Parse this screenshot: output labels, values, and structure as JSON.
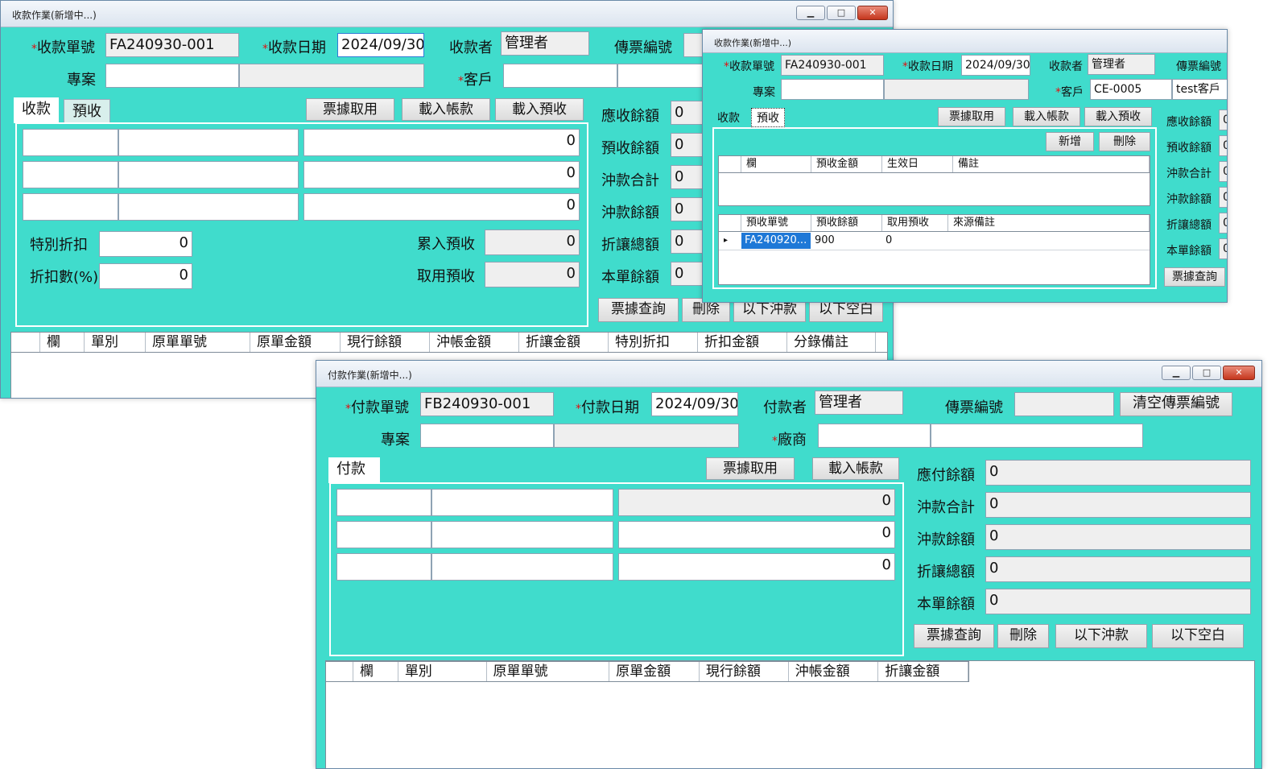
{
  "w1": {
    "title": "收款作業(新增中...)",
    "lbl_no": "收款單號",
    "no": "FA240930-001",
    "lbl_date": "收款日期",
    "date": "2024/09/30",
    "lbl_user": "收款者",
    "user": "管理者",
    "lbl_voucher": "傳票編號",
    "lbl_project": "專案",
    "lbl_customer": "客戶",
    "tab_receipt": "收款",
    "tab_prepay": "預收",
    "btn_take": "票據取用",
    "btn_load_acct": "載入帳款",
    "btn_load_pre": "載入預收",
    "amounts": [
      "0",
      "0",
      "0"
    ],
    "lbl_special": "特別折扣",
    "special": "0",
    "lbl_rate": "折扣數(%)",
    "rate": "0",
    "lbl_acc_pre": "累入預收",
    "acc_pre": "0",
    "lbl_take_pre": "取用預收",
    "take_pre": "0",
    "summary": [
      {
        "label": "應收餘額",
        "value": "0"
      },
      {
        "label": "預收餘額",
        "value": "0"
      },
      {
        "label": "沖款合計",
        "value": "0"
      },
      {
        "label": "沖款餘額",
        "value": "0"
      },
      {
        "label": "折讓總額",
        "value": "0"
      },
      {
        "label": "本單餘額",
        "value": "0"
      }
    ],
    "btn_query": "票據查詢",
    "btn_delete": "刪除",
    "btn_below_offset": "以下沖款",
    "btn_below_blank": "以下空白",
    "columns": [
      "欄",
      "單別",
      "原單單號",
      "原單金額",
      "現行餘額",
      "沖帳金額",
      "折讓金額",
      "特別折扣",
      "折扣金額",
      "分錄備註"
    ]
  },
  "w2": {
    "title": "收款作業(新增中...)",
    "lbl_no": "收款單號",
    "no": "FA240930-001",
    "lbl_date": "收款日期",
    "date": "2024/09/30",
    "lbl_user": "收款者",
    "user": "管理者",
    "lbl_voucher": "傳票編號",
    "lbl_project": "專案",
    "lbl_customer": "客戶",
    "customer_code": "CE-0005",
    "customer_name": "test客戶",
    "tab_receipt": "收款",
    "tab_prepay": "預收",
    "btn_take": "票據取用",
    "btn_load_acct": "載入帳款",
    "btn_load_pre": "載入預收",
    "btn_add": "新增",
    "btn_delete": "刪除",
    "grid1_cols": [
      "欄",
      "預收金額",
      "生效日",
      "備註"
    ],
    "grid2_cols": [
      "預收單號",
      "預收餘額",
      "取用預收",
      "來源備註"
    ],
    "grid2_row": {
      "no": "FA240920...",
      "balance": "900",
      "take": "0"
    },
    "summary": [
      "應收餘額",
      "預收餘額",
      "沖款合計",
      "沖款餘額",
      "折讓總額",
      "本單餘額"
    ],
    "summary_values": [
      "0",
      "0",
      "0",
      "0",
      "0",
      "0"
    ],
    "btn_query": "票據查詢"
  },
  "w3": {
    "title": "付款作業(新增中...)",
    "lbl_no": "付款單號",
    "no": "FB240930-001",
    "lbl_date": "付款日期",
    "date": "2024/09/30",
    "lbl_user": "付款者",
    "user": "管理者",
    "lbl_voucher": "傳票編號",
    "btn_clear_voucher": "清空傳票編號",
    "lbl_project": "專案",
    "lbl_vendor": "廠商",
    "tab_pay": "付款",
    "btn_take": "票據取用",
    "btn_load_acct": "載入帳款",
    "amounts": [
      "0",
      "0",
      "0"
    ],
    "summary": [
      {
        "label": "應付餘額",
        "value": "0"
      },
      {
        "label": "沖款合計",
        "value": "0"
      },
      {
        "label": "沖款餘額",
        "value": "0"
      },
      {
        "label": "折讓總額",
        "value": "0"
      },
      {
        "label": "本單餘額",
        "value": "0"
      }
    ],
    "btn_query": "票據查詢",
    "btn_delete": "刪除",
    "btn_below_offset": "以下沖款",
    "btn_below_blank": "以下空白",
    "columns": [
      "欄",
      "單別",
      "原單單號",
      "原單金額",
      "現行餘額",
      "沖帳金額",
      "折讓金額"
    ]
  }
}
